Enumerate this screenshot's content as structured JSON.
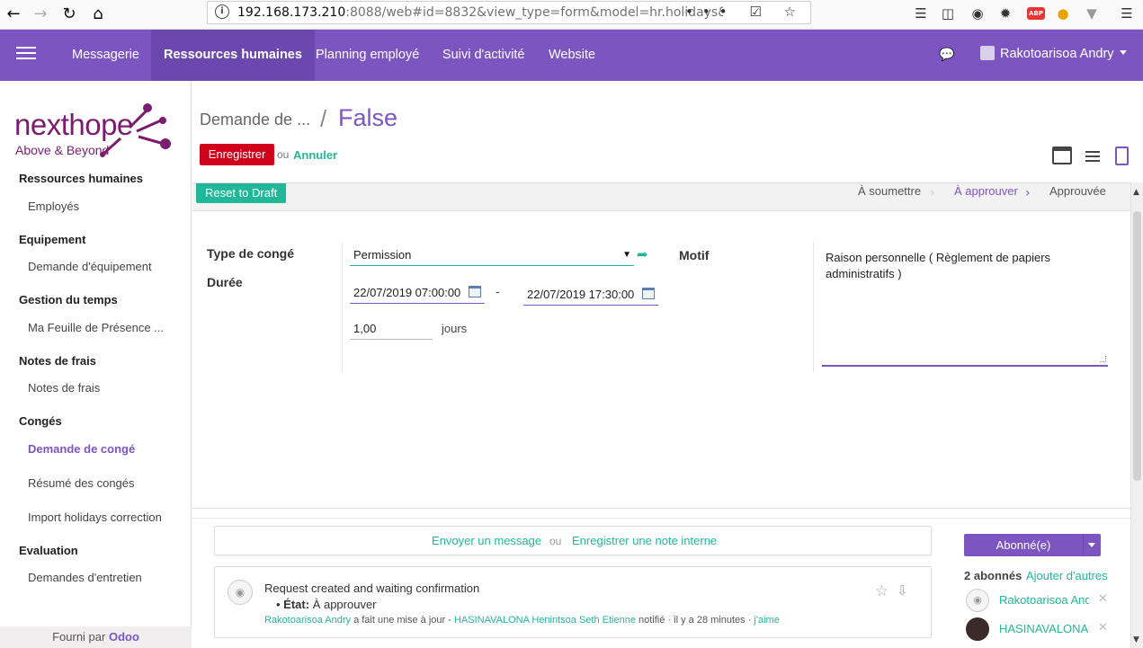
{
  "browser": {
    "url_host": "192.168.173.210",
    "url_rest": ":8088/web#id=8832&view_type=form&model=hr.holidays&menu_i",
    "url_actions": "••• ☑ ☆",
    "abp_label": "ABP"
  },
  "navbar": {
    "menu": [
      "Messagerie",
      "Ressources humaines",
      "Planning employé",
      "Suivi d'activité",
      "Website"
    ],
    "active_index": 1,
    "user": "Rakotoarisoa Andry"
  },
  "sidebar": {
    "logo_text": "nexthope",
    "logo_tagline": "Above & Beyond",
    "sections": [
      {
        "title": "Ressources humaines",
        "items": [
          "Employés"
        ]
      },
      {
        "title": "Equipement",
        "items": [
          "Demande d'équipement"
        ]
      },
      {
        "title": "Gestion du temps",
        "items": [
          "Ma Feuille de Présence ..."
        ]
      },
      {
        "title": "Notes de frais",
        "items": [
          "Notes de frais"
        ]
      },
      {
        "title": "Congés",
        "items": [
          "Demande de congé",
          "Résumé des congés",
          "Import holidays correction"
        ]
      },
      {
        "title": "Evaluation",
        "items": [
          "Demandes d'entretien"
        ]
      }
    ],
    "active_item": "Demande de congé",
    "powered_by": "Fourni par",
    "powered_brand": "Odoo"
  },
  "control": {
    "breadcrumb_parent": "Demande de ...",
    "breadcrumb_sep": "/",
    "breadcrumb_current": "False",
    "save_label": "Enregistrer",
    "or_label": "ou",
    "cancel_label": "Annuler"
  },
  "statusbar": {
    "reset_label": "Reset to Draft",
    "stages": [
      "À soumettre",
      "À approuver",
      "Approuvée"
    ],
    "active_stage": "À approuver"
  },
  "form": {
    "type_label": "Type de congé",
    "type_value": "Permission",
    "duration_label": "Durée",
    "date_from": "22/07/2019 07:00:00",
    "date_sep": "-",
    "date_to": "22/07/2019 17:30:00",
    "days_value": "1,00",
    "days_unit": "jours",
    "motif_label": "Motif",
    "motif_value": "Raison personnelle ( Règlement de papiers administratifs )"
  },
  "chatter": {
    "send_message": "Envoyer un message",
    "or": "ou",
    "log_note": "Enregistrer une note interne",
    "message": {
      "title": "Request created and waiting confirmation",
      "state_label": "État:",
      "state_value": "À approuver",
      "author": "Rakotoarisoa Andry",
      "action": "a fait une mise à jour",
      "notified": "HASINAVALONA Henintsoa Seth Etienne",
      "notified_suffix": "notifié",
      "time": "il y a 28 minutes",
      "like": "j'aime"
    },
    "follow_label": "Abonné(e)",
    "followers_count": "2 abonnés",
    "add_followers": "Ajouter d'autres",
    "followers": [
      "Rakotoarisoa Andry",
      "HASINAVALONA Henintsoa Seth Etienne"
    ]
  },
  "colors": {
    "brand": "#7c55c1",
    "accent": "#21b799",
    "save": "#d0011b"
  }
}
